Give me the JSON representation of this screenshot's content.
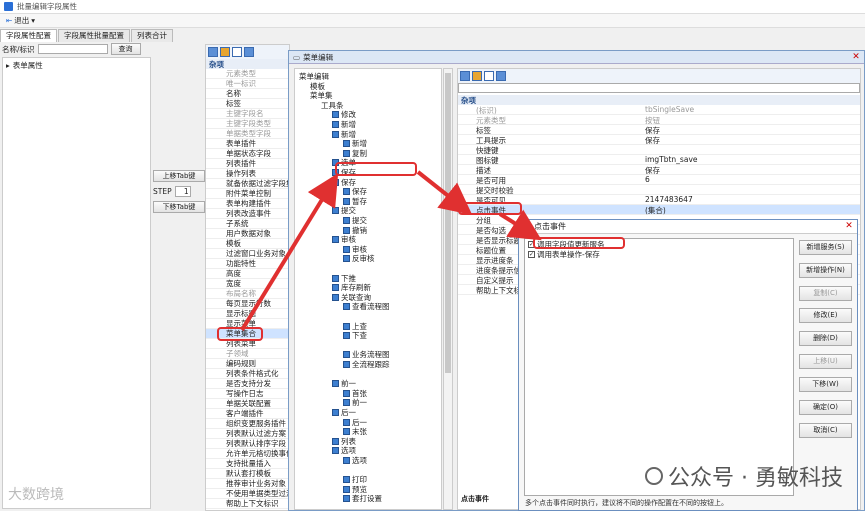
{
  "window": {
    "title": "批量编辑字段属性"
  },
  "toolbar": {
    "exit": "退出"
  },
  "tabs": [
    "字段属性配置",
    "字段属性批量配置",
    "列表合计"
  ],
  "search": {
    "label": "名称/标识",
    "button": "查询"
  },
  "left_tree": {
    "root": "表单属性"
  },
  "mid": {
    "up": "上移Tab键",
    "step_label": "STEP",
    "step_value": "1",
    "down": "下移Tab键"
  },
  "pg": {
    "cat": "杂项",
    "rows": [
      "元素类型",
      "唯一标识",
      "名称",
      "标签",
      "主键字段名",
      "主键字段类型",
      "单据类型字段",
      "表单插件",
      "单据状态字段",
      "列表插件",
      "操作列表",
      "就备依据过滤字段集合",
      "附件菜单控制",
      "表单构建插件",
      "列表改造事件",
      "子系统",
      "用户数据对象",
      "模板",
      "过滤窗口业务对象",
      "功能特性",
      "高度",
      "宽度",
      "布局名称",
      "每页显示行数",
      "显示标题",
      "显示菜单",
      "菜单集合",
      "列表菜单",
      "子领域",
      "编码规则",
      "列表条件格式化",
      "是否支持分发",
      "写操作日志",
      "单据关联配置",
      "客户端插件",
      "组织变更服务插件",
      "列表默认过滤方案",
      "列表默认排序字段",
      "允许单元格切换事件",
      "支持批量插入",
      "默认套打模板",
      "推荐审计业务对象",
      "不使用单据类型过滤",
      "帮助上下文标识"
    ],
    "dim": [
      0,
      1,
      4,
      5,
      6,
      22,
      28
    ],
    "sel": 26
  },
  "dlg1": {
    "title": "菜单编辑"
  },
  "mtree": [
    {
      "t": "菜单编辑",
      "d": 0
    },
    {
      "t": "模板",
      "d": 1
    },
    {
      "t": "菜单集",
      "d": 1
    },
    {
      "t": "工具条",
      "d": 2
    },
    {
      "t": "修改",
      "d": 3
    },
    {
      "t": "新增",
      "d": 3
    },
    {
      "t": "新增",
      "d": 3
    },
    {
      "t": "新增",
      "d": 4
    },
    {
      "t": "复制",
      "d": 4
    },
    {
      "t": "选单",
      "d": 3
    },
    {
      "t": "保存",
      "d": 3
    },
    {
      "t": "保存",
      "d": 3
    },
    {
      "t": "保存",
      "d": 4
    },
    {
      "t": "暂存",
      "d": 4
    },
    {
      "t": "提交",
      "d": 3
    },
    {
      "t": "提交",
      "d": 4
    },
    {
      "t": "撤销",
      "d": 4
    },
    {
      "t": "审核",
      "d": 3
    },
    {
      "t": "审核",
      "d": 4
    },
    {
      "t": "反审核",
      "d": 4
    },
    {
      "t": "",
      "d": 3
    },
    {
      "t": "下推",
      "d": 3
    },
    {
      "t": "库存刷新",
      "d": 3
    },
    {
      "t": "关联查询",
      "d": 3
    },
    {
      "t": "查看流程图",
      "d": 4
    },
    {
      "t": "",
      "d": 4
    },
    {
      "t": "上查",
      "d": 4
    },
    {
      "t": "下查",
      "d": 4
    },
    {
      "t": "",
      "d": 4
    },
    {
      "t": "业务流程图",
      "d": 4
    },
    {
      "t": "全流程跟踪",
      "d": 4
    },
    {
      "t": "",
      "d": 3
    },
    {
      "t": "前一",
      "d": 3
    },
    {
      "t": "首张",
      "d": 4
    },
    {
      "t": "前一",
      "d": 4
    },
    {
      "t": "后一",
      "d": 3
    },
    {
      "t": "后一",
      "d": 4
    },
    {
      "t": "末张",
      "d": 4
    },
    {
      "t": "列表",
      "d": 3
    },
    {
      "t": "选项",
      "d": 3
    },
    {
      "t": "选项",
      "d": 4
    },
    {
      "t": "",
      "d": 4
    },
    {
      "t": "打印",
      "d": 4
    },
    {
      "t": "预览",
      "d": 4
    },
    {
      "t": "套打设置",
      "d": 4
    }
  ],
  "rpg": {
    "cat": "杂项",
    "rows": [
      {
        "k": "(标识)",
        "v": "tbSingleSave",
        "dim": true
      },
      {
        "k": "元素类型",
        "v": "按钮",
        "dim": true
      },
      {
        "k": "标签",
        "v": "保存"
      },
      {
        "k": "工具提示",
        "v": "保存"
      },
      {
        "k": "快捷键",
        "v": ""
      },
      {
        "k": "图标键",
        "v": "imgTbtn_save"
      },
      {
        "k": "描述",
        "v": "保存"
      },
      {
        "k": "是否可用",
        "v": "6"
      },
      {
        "k": "提交时校验",
        "v": ""
      },
      {
        "k": "是否可见",
        "v": "2147483647"
      },
      {
        "k": "点击事件",
        "v": "(集合)",
        "sel": true
      },
      {
        "k": "分组",
        "v": ""
      },
      {
        "k": "是否勾选",
        "v": ""
      },
      {
        "k": "是否显示标题",
        "v": ""
      },
      {
        "k": "标题位置",
        "v": ""
      },
      {
        "k": "显示进度条",
        "v": ""
      },
      {
        "k": "进度条提示信",
        "v": ""
      },
      {
        "k": "自定义提示",
        "v": ""
      },
      {
        "k": "帮助上下文标",
        "v": ""
      }
    ]
  },
  "dlg2": {
    "title": "点击事件",
    "items": [
      "调用字段值更新服务",
      "调用表单操作-保存"
    ],
    "buttons": [
      "新增服务(S)",
      "新增操作(N)",
      "复制(C)",
      "修改(E)",
      "删除(D)",
      "上移(U)",
      "下移(W)",
      "确定(O)",
      "取消(C)"
    ],
    "disabled": [
      2,
      5
    ],
    "note": "多个点击事件同时执行，建议将不同的操作配置在不同的按钮上。"
  },
  "event_label": "点击事件",
  "watermark": "公众号 · 勇敏科技",
  "watermark2": "大数跨境"
}
